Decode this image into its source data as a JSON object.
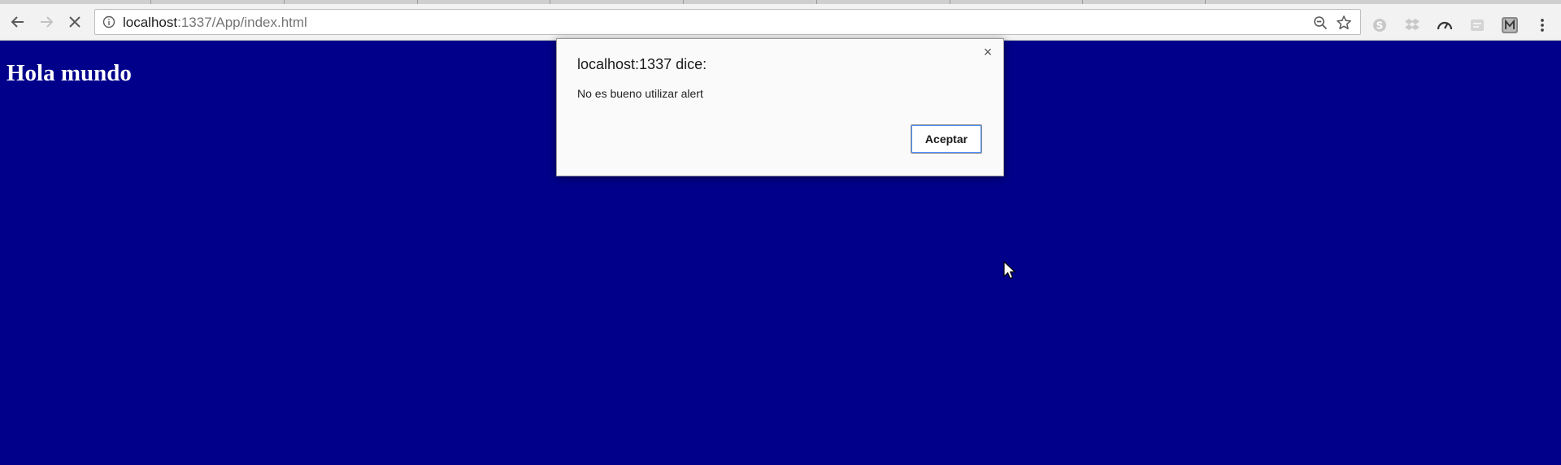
{
  "browser": {
    "url_host": "localhost",
    "url_path": ":1337/App/index.html",
    "nav_icons": [
      "back-arrow-icon",
      "forward-arrow-icon",
      "stop-loading-icon"
    ],
    "omnibox_icons": [
      "info-icon",
      "zoom-out-icon",
      "star-bookmark-icon"
    ],
    "extension_icons": [
      "skype-icon",
      "dropbox-icon",
      "speedometer-icon",
      "extension-icon",
      "m-extension-icon",
      "menu-kebab-icon"
    ]
  },
  "page": {
    "heading": "Hola mundo",
    "background_color": "#00008b",
    "heading_color": "#ffffff"
  },
  "dialog": {
    "title": "localhost:1337 dice:",
    "message": "No es bueno utilizar alert",
    "ok_label": "Aceptar",
    "close_symbol": "×"
  },
  "colors": {
    "toolbar_bg": "#f2f2f2",
    "dialog_bg": "#fafafa",
    "focus_ring": "#4d90fe"
  }
}
